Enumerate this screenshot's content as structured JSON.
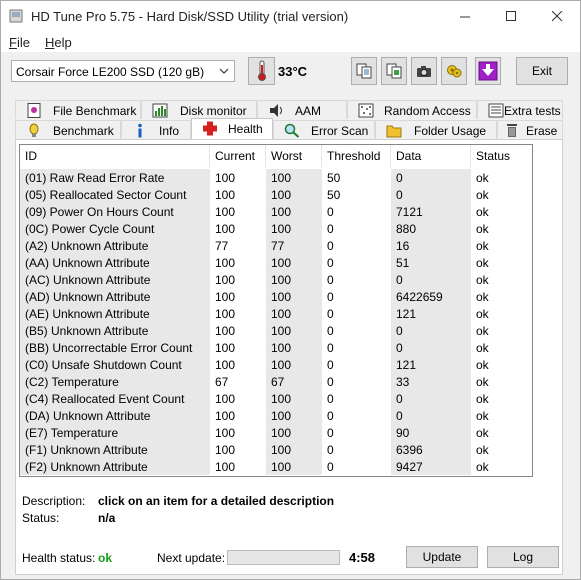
{
  "window": {
    "title": "HD Tune Pro 5.75 - Hard Disk/SSD Utility (trial version)",
    "controls": [
      "minimize",
      "maximize",
      "close"
    ]
  },
  "menu": [
    {
      "label": "File",
      "accel": "F",
      "rest": "ile"
    },
    {
      "label": "Help",
      "accel": "H",
      "rest": "elp"
    }
  ],
  "toolbar": {
    "drive": "Corsair Force LE200 SSD (120 gB)",
    "temperature": "33°C",
    "exit_label": "Exit",
    "icons": [
      "thermometer-icon",
      "copy-text-icon",
      "copy-image-icon",
      "camera-icon",
      "options-icon",
      "save-icon"
    ]
  },
  "tabs_row1": [
    {
      "label": "File Benchmark",
      "icon": "file-benchmark-icon"
    },
    {
      "label": "Disk monitor",
      "icon": "disk-monitor-icon"
    },
    {
      "label": "AAM",
      "icon": "aam-icon"
    },
    {
      "label": "Random Access",
      "icon": "random-access-icon"
    },
    {
      "label": "Extra tests",
      "icon": "extra-tests-icon"
    }
  ],
  "tabs_row2": [
    {
      "label": "Benchmark",
      "icon": "benchmark-icon"
    },
    {
      "label": "Info",
      "icon": "info-icon"
    },
    {
      "label": "Health",
      "icon": "health-icon",
      "active": true
    },
    {
      "label": "Error Scan",
      "icon": "error-scan-icon"
    },
    {
      "label": "Folder Usage",
      "icon": "folder-icon"
    },
    {
      "label": "Erase",
      "icon": "trash-icon"
    }
  ],
  "table": {
    "columns": [
      "ID",
      "Current",
      "Worst",
      "Threshold",
      "Data",
      "Status"
    ],
    "rows": [
      [
        "(01) Raw Read Error Rate",
        "100",
        "100",
        "50",
        "0",
        "ok"
      ],
      [
        "(05) Reallocated Sector Count",
        "100",
        "100",
        "50",
        "0",
        "ok"
      ],
      [
        "(09) Power On Hours Count",
        "100",
        "100",
        "0",
        "7121",
        "ok"
      ],
      [
        "(0C) Power Cycle Count",
        "100",
        "100",
        "0",
        "880",
        "ok"
      ],
      [
        "(A2) Unknown Attribute",
        "77",
        "77",
        "0",
        "16",
        "ok"
      ],
      [
        "(AA) Unknown Attribute",
        "100",
        "100",
        "0",
        "51",
        "ok"
      ],
      [
        "(AC) Unknown Attribute",
        "100",
        "100",
        "0",
        "0",
        "ok"
      ],
      [
        "(AD) Unknown Attribute",
        "100",
        "100",
        "0",
        "6422659",
        "ok"
      ],
      [
        "(AE) Unknown Attribute",
        "100",
        "100",
        "0",
        "121",
        "ok"
      ],
      [
        "(B5) Unknown Attribute",
        "100",
        "100",
        "0",
        "0",
        "ok"
      ],
      [
        "(BB) Uncorrectable Error Count",
        "100",
        "100",
        "0",
        "0",
        "ok"
      ],
      [
        "(C0) Unsafe Shutdown Count",
        "100",
        "100",
        "0",
        "121",
        "ok"
      ],
      [
        "(C2) Temperature",
        "67",
        "67",
        "0",
        "33",
        "ok"
      ],
      [
        "(C4) Reallocated Event Count",
        "100",
        "100",
        "0",
        "0",
        "ok"
      ],
      [
        "(DA) Unknown Attribute",
        "100",
        "100",
        "0",
        "0",
        "ok"
      ],
      [
        "(E7) Temperature",
        "100",
        "100",
        "0",
        "90",
        "ok"
      ],
      [
        "(F1) Unknown Attribute",
        "100",
        "100",
        "0",
        "6396",
        "ok"
      ],
      [
        "(F2) Unknown Attribute",
        "100",
        "100",
        "0",
        "9427",
        "ok"
      ]
    ]
  },
  "details": {
    "description_label": "Description:",
    "description_value": "click on an item for a detailed description",
    "status_label": "Status:",
    "status_value": "n/a"
  },
  "footer": {
    "health_label": "Health status:",
    "health_value": "ok",
    "next_update_label": "Next update:",
    "countdown": "4:58",
    "progress_fraction": 0.0,
    "update_label": "Update",
    "log_label": "Log"
  },
  "colors": {
    "ok_green": "#16a016",
    "thermometer_red": "#cc1a1a",
    "save_purple": "#a020c8"
  }
}
